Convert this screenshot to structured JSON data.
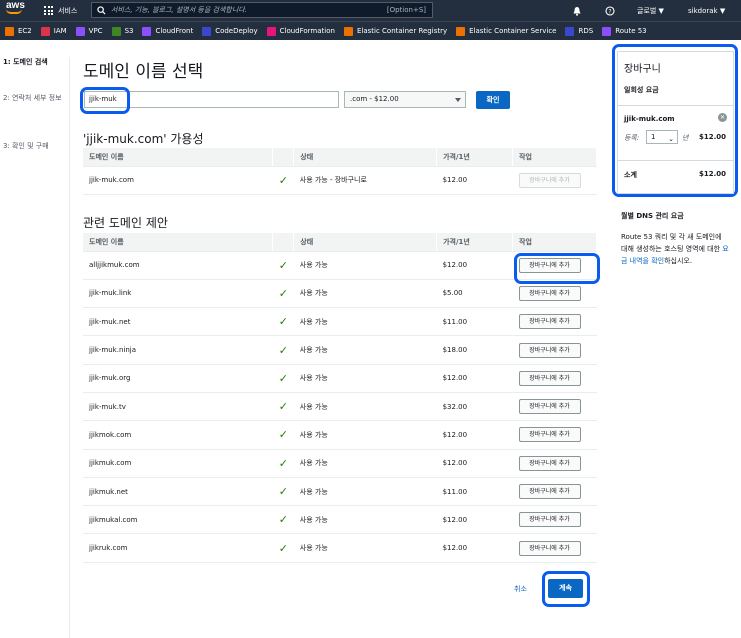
{
  "topnav": {
    "logo": "aws",
    "services_label": "서비스",
    "search_placeholder": "서비스, 기능, 블로그, 설명서 등을 검색합니다.",
    "search_shortcut": "[Option+S]",
    "region_label": "글로벌 ▼",
    "user_label": "sikdorak ▼"
  },
  "favorites": [
    {
      "label": "EC2",
      "color": "#ed7100"
    },
    {
      "label": "IAM",
      "color": "#dd344c"
    },
    {
      "label": "VPC",
      "color": "#8c4fff"
    },
    {
      "label": "S3",
      "color": "#3f8624"
    },
    {
      "label": "CloudFront",
      "color": "#8c4fff"
    },
    {
      "label": "CodeDeploy",
      "color": "#3b48cc"
    },
    {
      "label": "CloudFormation",
      "color": "#e7157b"
    },
    {
      "label": "Elastic Container Registry",
      "color": "#ed7100"
    },
    {
      "label": "Elastic Container Service",
      "color": "#ed7100"
    },
    {
      "label": "RDS",
      "color": "#3b48cc"
    },
    {
      "label": "Route 53",
      "color": "#8c4fff"
    }
  ],
  "steps": [
    "1: 도메인 검색",
    "2: 연락처 세부 정보",
    "3: 확인 및 구매"
  ],
  "page_title": "도메인 이름 선택",
  "search": {
    "domain_value": "jjik-muk",
    "tld_value": ".com - $12.00",
    "check_label": "확인"
  },
  "availability": {
    "heading": "'jjik-muk.com' 가용성",
    "headers": [
      "도메인 이름",
      "",
      "상태",
      "가격/1년",
      "작업"
    ],
    "rows": [
      {
        "domain": "jjik-muk.com",
        "status": "사용 가능 - 장바구니로",
        "price": "$12.00",
        "action": "장바구니에 추가"
      }
    ]
  },
  "suggestions": {
    "heading": "관련 도메인 제안",
    "headers": [
      "도메인 이름",
      "",
      "상태",
      "가격/1년",
      "작업"
    ],
    "rows": [
      {
        "domain": "alljjikmuk.com",
        "status": "사용 가능",
        "price": "$12.00",
        "action": "장바구니에 추가"
      },
      {
        "domain": "jjik-muk.link",
        "status": "사용 가능",
        "price": "$5.00",
        "action": "장바구니에 추가"
      },
      {
        "domain": "jjik-muk.net",
        "status": "사용 가능",
        "price": "$11.00",
        "action": "장바구니에 추가"
      },
      {
        "domain": "jjik-muk.ninja",
        "status": "사용 가능",
        "price": "$18.00",
        "action": "장바구니에 추가"
      },
      {
        "domain": "jjik-muk.org",
        "status": "사용 가능",
        "price": "$12.00",
        "action": "장바구니에 추가"
      },
      {
        "domain": "jjik-muk.tv",
        "status": "사용 가능",
        "price": "$32.00",
        "action": "장바구니에 추가"
      },
      {
        "domain": "jjikmok.com",
        "status": "사용 가능",
        "price": "$12.00",
        "action": "장바구니에 추가"
      },
      {
        "domain": "jjikmuk.com",
        "status": "사용 가능",
        "price": "$12.00",
        "action": "장바구니에 추가"
      },
      {
        "domain": "jjikmuk.net",
        "status": "사용 가능",
        "price": "$11.00",
        "action": "장바구니에 추가"
      },
      {
        "domain": "jjikmukal.com",
        "status": "사용 가능",
        "price": "$12.00",
        "action": "장바구니에 추가"
      },
      {
        "domain": "jjikruk.com",
        "status": "사용 가능",
        "price": "$12.00",
        "action": "장바구니에 추가"
      }
    ]
  },
  "footer": {
    "cancel_label": "취소",
    "continue_label": "계속"
  },
  "cart": {
    "title": "장바구니",
    "onetime_label": "일회성 요금",
    "domain": "jjik-muk.com",
    "remove_icon": "x-circle-icon",
    "register_label": "등록:",
    "years_value": "1",
    "year_unit": "년",
    "price": "$12.00",
    "subtotal_label": "소계",
    "subtotal": "$12.00"
  },
  "dns": {
    "title": "월별 DNS 관리 요금",
    "text_before": "Route 53 쿼리 및 각 새 도메인에 대해 생성하는 호스팅 영역에 대한 ",
    "link": "요금 내역을 확인",
    "text_after": "하십시오."
  }
}
